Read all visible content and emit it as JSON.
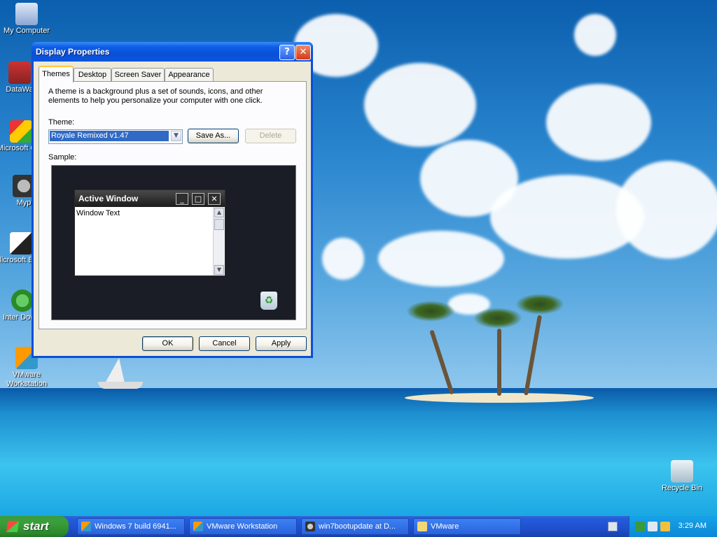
{
  "desktop": {
    "icons": [
      {
        "label": "My Computer"
      },
      {
        "label": "DataWa"
      },
      {
        "label": "Microsoft C++"
      },
      {
        "label": "Myp"
      },
      {
        "label": "Microsoft Basic"
      },
      {
        "label": "Inter Downl"
      },
      {
        "label": "VMware Workstation"
      },
      {
        "label": "Recycle Bin"
      }
    ]
  },
  "dialog": {
    "title": "Display Properties",
    "help_glyph": "?",
    "close_glyph": "✕",
    "tabs": [
      "Themes",
      "Desktop",
      "Screen Saver",
      "Appearance"
    ],
    "active_tab": "Themes",
    "description": "A theme is a background plus a set of sounds, icons, and other elements to help you personalize your computer with one click.",
    "theme_label": "Theme:",
    "theme_value": "Royale Remixed v1.47",
    "save_as_label": "Save As...",
    "delete_label": "Delete",
    "sample_label": "Sample:",
    "sample": {
      "window_title": "Active Window",
      "window_text": "Window Text"
    },
    "ok_label": "OK",
    "cancel_label": "Cancel",
    "apply_label": "Apply"
  },
  "taskbar": {
    "start_label": "start",
    "items": [
      {
        "label": "Windows 7 build 6941..."
      },
      {
        "label": "VMware Workstation"
      },
      {
        "label": "win7bootupdate at D..."
      },
      {
        "label": "VMware"
      }
    ],
    "clock": "3:29 AM"
  }
}
